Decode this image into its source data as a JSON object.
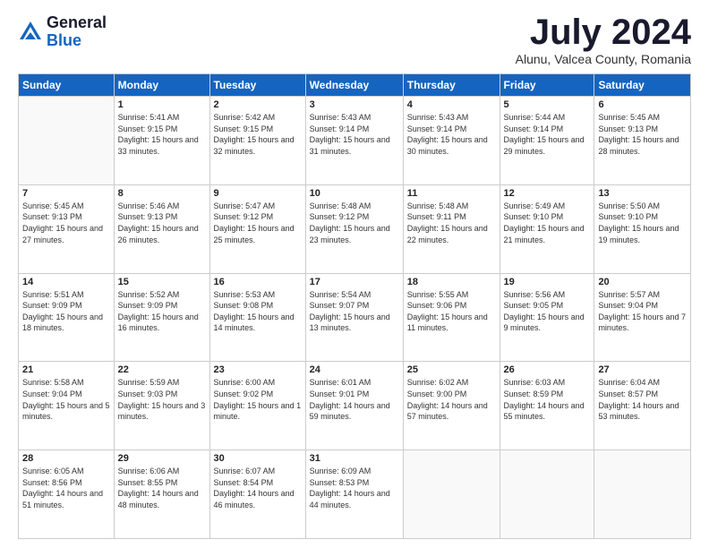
{
  "logo": {
    "general": "General",
    "blue": "Blue"
  },
  "title": "July 2024",
  "location": "Alunu, Valcea County, Romania",
  "weekdays": [
    "Sunday",
    "Monday",
    "Tuesday",
    "Wednesday",
    "Thursday",
    "Friday",
    "Saturday"
  ],
  "weeks": [
    [
      {
        "day": "",
        "sunrise": "",
        "sunset": "",
        "daylight": ""
      },
      {
        "day": "1",
        "sunrise": "Sunrise: 5:41 AM",
        "sunset": "Sunset: 9:15 PM",
        "daylight": "Daylight: 15 hours and 33 minutes."
      },
      {
        "day": "2",
        "sunrise": "Sunrise: 5:42 AM",
        "sunset": "Sunset: 9:15 PM",
        "daylight": "Daylight: 15 hours and 32 minutes."
      },
      {
        "day": "3",
        "sunrise": "Sunrise: 5:43 AM",
        "sunset": "Sunset: 9:14 PM",
        "daylight": "Daylight: 15 hours and 31 minutes."
      },
      {
        "day": "4",
        "sunrise": "Sunrise: 5:43 AM",
        "sunset": "Sunset: 9:14 PM",
        "daylight": "Daylight: 15 hours and 30 minutes."
      },
      {
        "day": "5",
        "sunrise": "Sunrise: 5:44 AM",
        "sunset": "Sunset: 9:14 PM",
        "daylight": "Daylight: 15 hours and 29 minutes."
      },
      {
        "day": "6",
        "sunrise": "Sunrise: 5:45 AM",
        "sunset": "Sunset: 9:13 PM",
        "daylight": "Daylight: 15 hours and 28 minutes."
      }
    ],
    [
      {
        "day": "7",
        "sunrise": "Sunrise: 5:45 AM",
        "sunset": "Sunset: 9:13 PM",
        "daylight": "Daylight: 15 hours and 27 minutes."
      },
      {
        "day": "8",
        "sunrise": "Sunrise: 5:46 AM",
        "sunset": "Sunset: 9:13 PM",
        "daylight": "Daylight: 15 hours and 26 minutes."
      },
      {
        "day": "9",
        "sunrise": "Sunrise: 5:47 AM",
        "sunset": "Sunset: 9:12 PM",
        "daylight": "Daylight: 15 hours and 25 minutes."
      },
      {
        "day": "10",
        "sunrise": "Sunrise: 5:48 AM",
        "sunset": "Sunset: 9:12 PM",
        "daylight": "Daylight: 15 hours and 23 minutes."
      },
      {
        "day": "11",
        "sunrise": "Sunrise: 5:48 AM",
        "sunset": "Sunset: 9:11 PM",
        "daylight": "Daylight: 15 hours and 22 minutes."
      },
      {
        "day": "12",
        "sunrise": "Sunrise: 5:49 AM",
        "sunset": "Sunset: 9:10 PM",
        "daylight": "Daylight: 15 hours and 21 minutes."
      },
      {
        "day": "13",
        "sunrise": "Sunrise: 5:50 AM",
        "sunset": "Sunset: 9:10 PM",
        "daylight": "Daylight: 15 hours and 19 minutes."
      }
    ],
    [
      {
        "day": "14",
        "sunrise": "Sunrise: 5:51 AM",
        "sunset": "Sunset: 9:09 PM",
        "daylight": "Daylight: 15 hours and 18 minutes."
      },
      {
        "day": "15",
        "sunrise": "Sunrise: 5:52 AM",
        "sunset": "Sunset: 9:09 PM",
        "daylight": "Daylight: 15 hours and 16 minutes."
      },
      {
        "day": "16",
        "sunrise": "Sunrise: 5:53 AM",
        "sunset": "Sunset: 9:08 PM",
        "daylight": "Daylight: 15 hours and 14 minutes."
      },
      {
        "day": "17",
        "sunrise": "Sunrise: 5:54 AM",
        "sunset": "Sunset: 9:07 PM",
        "daylight": "Daylight: 15 hours and 13 minutes."
      },
      {
        "day": "18",
        "sunrise": "Sunrise: 5:55 AM",
        "sunset": "Sunset: 9:06 PM",
        "daylight": "Daylight: 15 hours and 11 minutes."
      },
      {
        "day": "19",
        "sunrise": "Sunrise: 5:56 AM",
        "sunset": "Sunset: 9:05 PM",
        "daylight": "Daylight: 15 hours and 9 minutes."
      },
      {
        "day": "20",
        "sunrise": "Sunrise: 5:57 AM",
        "sunset": "Sunset: 9:04 PM",
        "daylight": "Daylight: 15 hours and 7 minutes."
      }
    ],
    [
      {
        "day": "21",
        "sunrise": "Sunrise: 5:58 AM",
        "sunset": "Sunset: 9:04 PM",
        "daylight": "Daylight: 15 hours and 5 minutes."
      },
      {
        "day": "22",
        "sunrise": "Sunrise: 5:59 AM",
        "sunset": "Sunset: 9:03 PM",
        "daylight": "Daylight: 15 hours and 3 minutes."
      },
      {
        "day": "23",
        "sunrise": "Sunrise: 6:00 AM",
        "sunset": "Sunset: 9:02 PM",
        "daylight": "Daylight: 15 hours and 1 minute."
      },
      {
        "day": "24",
        "sunrise": "Sunrise: 6:01 AM",
        "sunset": "Sunset: 9:01 PM",
        "daylight": "Daylight: 14 hours and 59 minutes."
      },
      {
        "day": "25",
        "sunrise": "Sunrise: 6:02 AM",
        "sunset": "Sunset: 9:00 PM",
        "daylight": "Daylight: 14 hours and 57 minutes."
      },
      {
        "day": "26",
        "sunrise": "Sunrise: 6:03 AM",
        "sunset": "Sunset: 8:59 PM",
        "daylight": "Daylight: 14 hours and 55 minutes."
      },
      {
        "day": "27",
        "sunrise": "Sunrise: 6:04 AM",
        "sunset": "Sunset: 8:57 PM",
        "daylight": "Daylight: 14 hours and 53 minutes."
      }
    ],
    [
      {
        "day": "28",
        "sunrise": "Sunrise: 6:05 AM",
        "sunset": "Sunset: 8:56 PM",
        "daylight": "Daylight: 14 hours and 51 minutes."
      },
      {
        "day": "29",
        "sunrise": "Sunrise: 6:06 AM",
        "sunset": "Sunset: 8:55 PM",
        "daylight": "Daylight: 14 hours and 48 minutes."
      },
      {
        "day": "30",
        "sunrise": "Sunrise: 6:07 AM",
        "sunset": "Sunset: 8:54 PM",
        "daylight": "Daylight: 14 hours and 46 minutes."
      },
      {
        "day": "31",
        "sunrise": "Sunrise: 6:09 AM",
        "sunset": "Sunset: 8:53 PM",
        "daylight": "Daylight: 14 hours and 44 minutes."
      },
      {
        "day": "",
        "sunrise": "",
        "sunset": "",
        "daylight": ""
      },
      {
        "day": "",
        "sunrise": "",
        "sunset": "",
        "daylight": ""
      },
      {
        "day": "",
        "sunrise": "",
        "sunset": "",
        "daylight": ""
      }
    ]
  ]
}
